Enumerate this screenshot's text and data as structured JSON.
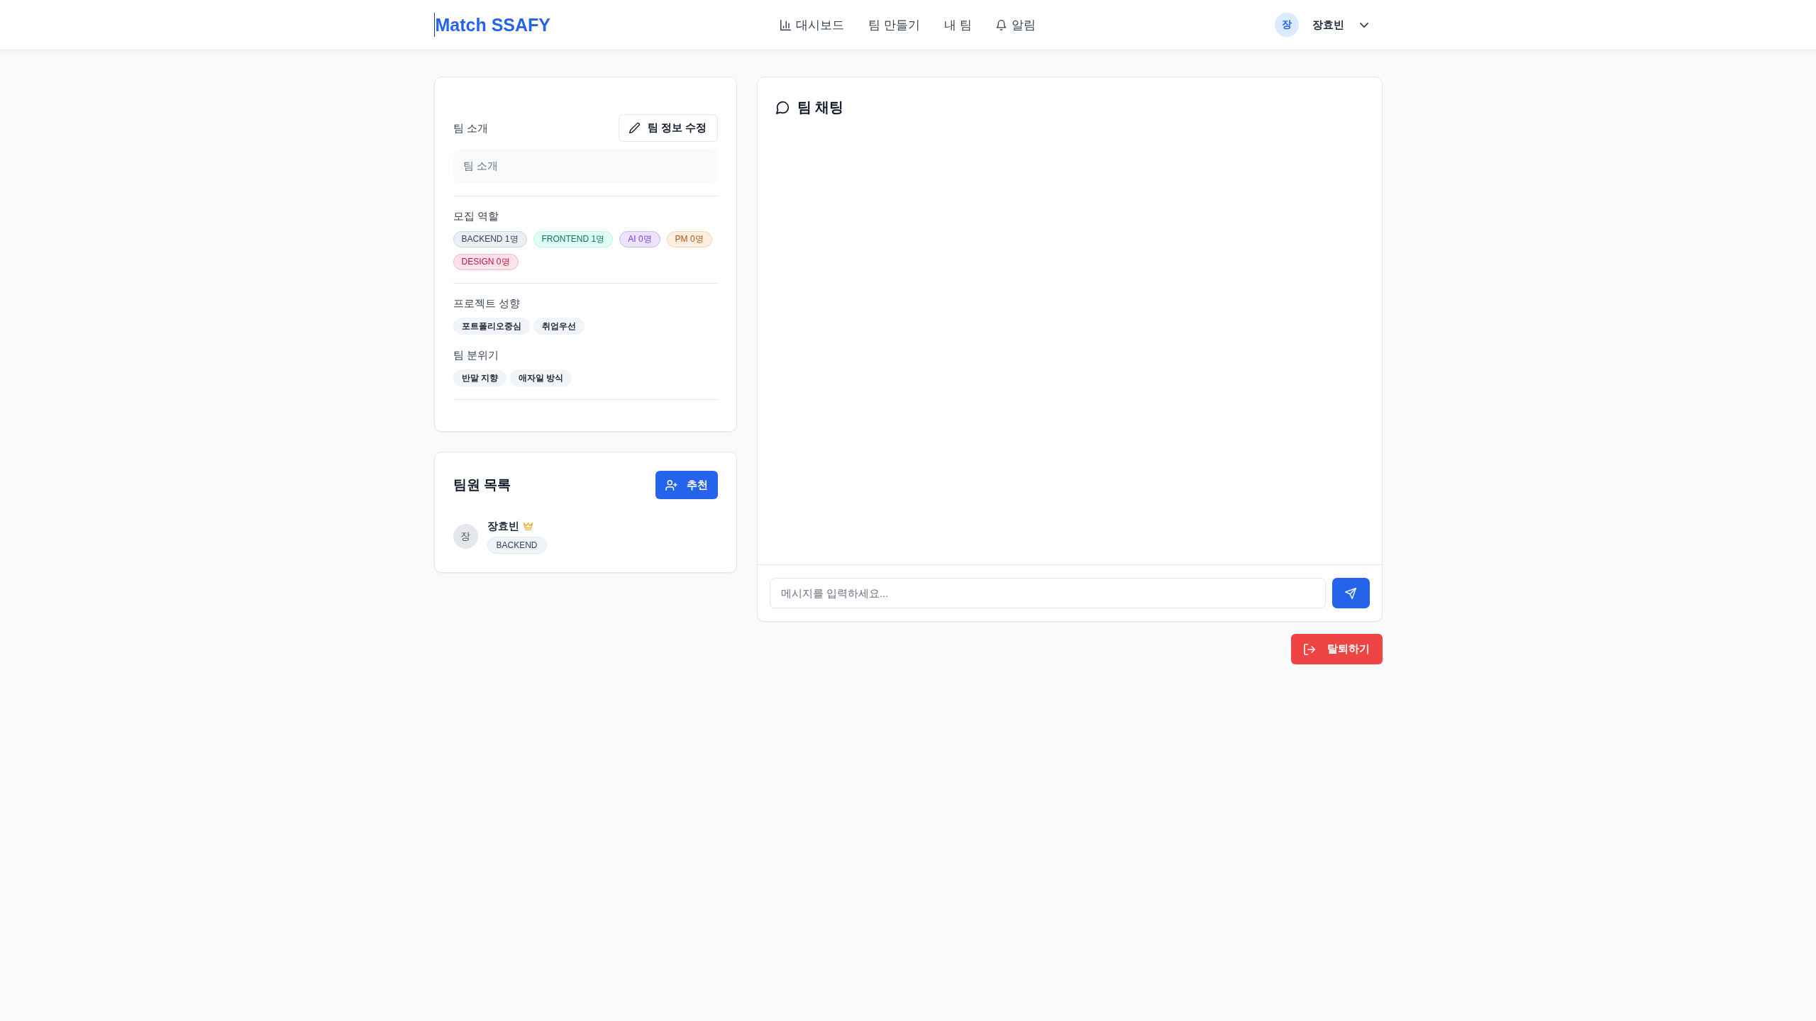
{
  "header": {
    "logo": "Match SSAFY",
    "nav": [
      {
        "label": "대시보드",
        "kind": "chart",
        "selected": false
      },
      {
        "label": "팀 만들기",
        "kind": "plain",
        "selected": false
      },
      {
        "label": "내 팀",
        "kind": "plain",
        "selected": false
      },
      {
        "label": "알림",
        "kind": "bell",
        "selected": false
      }
    ],
    "user": {
      "avatar": "장",
      "name": "장효빈"
    }
  },
  "team_info": {
    "intro_label": "팀 소개",
    "edit_button": "팀 정보 수정",
    "intro": "팀 소개",
    "roles_label": "모집 역할",
    "roles": [
      {
        "label": "BACKEND 1명",
        "color": "#334155"
      },
      {
        "label": "FRONTEND 1명",
        "color": "#047857"
      },
      {
        "label": "AI 0명",
        "color": "#7c3aed"
      },
      {
        "label": "PM 0명",
        "color": "#b45309"
      },
      {
        "label": "DESIGN 0명",
        "color": "#be123c"
      }
    ],
    "style_label": "프로젝트 성향",
    "styles": [
      "포트폴리오중심",
      "취업우선"
    ],
    "mood_label": "팀 분위기",
    "moods": [
      "반말 지향",
      "애자일 방식"
    ]
  },
  "members": {
    "title": "팀원 목록",
    "recommend_button": "추천",
    "list": [
      {
        "avatar": "장",
        "name": "장효빈",
        "leader": true,
        "role": "BACKEND"
      }
    ]
  },
  "chat": {
    "title": "팀 채팅",
    "input": {
      "placeholder": "메시지를 입력하세요..."
    }
  },
  "leave_button": "탈퇴하기"
}
